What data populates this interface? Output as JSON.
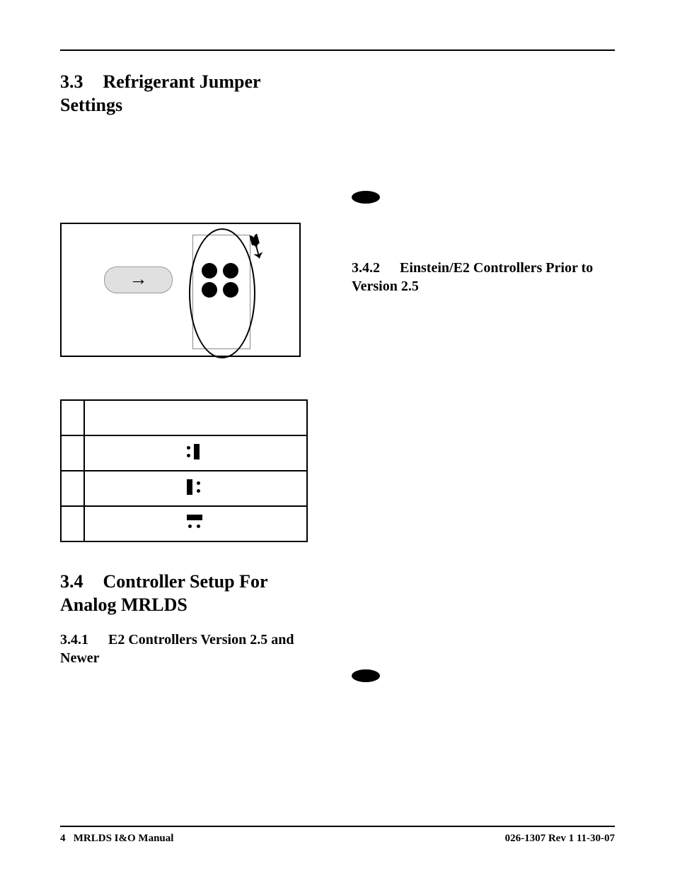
{
  "sections": {
    "s33": {
      "num": "3.3",
      "title": "Refrigerant Jumper Settings"
    },
    "s34": {
      "num": "3.4",
      "title": "Controller Setup For Analog MRLDS"
    },
    "s341": {
      "num": "3.4.1",
      "title": "E2 Controllers Version 2.5 and Newer"
    },
    "s342": {
      "num": "3.4.2",
      "title": "Einstein/E2 Controllers Prior to Version 2.5"
    }
  },
  "figure": {
    "label_arrow": "→"
  },
  "table": {
    "headers": [
      "",
      ""
    ],
    "rows": [
      {
        "c1": "",
        "c2": "icon1"
      },
      {
        "c1": "",
        "c2": "icon2"
      },
      {
        "c1": "",
        "c2": "icon3"
      }
    ]
  },
  "footer": {
    "left_page": "4",
    "left_title": "MRLDS I&O Manual",
    "right": "026-1307 Rev 1 11-30-07"
  }
}
